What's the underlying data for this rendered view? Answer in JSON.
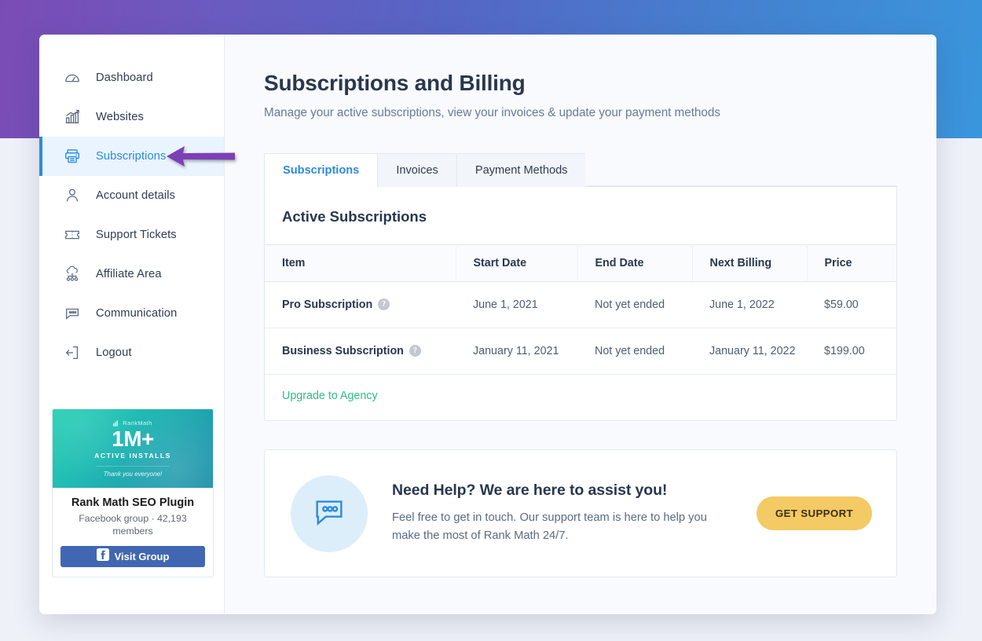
{
  "theme": {
    "gradient_start": "#7b4bb5",
    "gradient_end": "#3a96dc",
    "accent_blue": "#2b8ae0",
    "accent_green": "#2dbd84",
    "accent_yellow": "#f3ca63",
    "facebook_blue": "#4267b2",
    "page_bg": "#eef1f8"
  },
  "sidebar": {
    "items": [
      {
        "label": "Dashboard",
        "icon": "gauge-icon",
        "active": false
      },
      {
        "label": "Websites",
        "icon": "bar-chart-icon",
        "active": false
      },
      {
        "label": "Subscriptions",
        "icon": "invoice-printer-icon",
        "active": true
      },
      {
        "label": "Account details",
        "icon": "user-icon",
        "active": false
      },
      {
        "label": "Support Tickets",
        "icon": "ticket-icon",
        "active": false
      },
      {
        "label": "Affiliate Area",
        "icon": "affiliate-network-icon",
        "active": false
      },
      {
        "label": "Communication",
        "icon": "speech-bubble-icon",
        "active": false
      },
      {
        "label": "Logout",
        "icon": "logout-icon",
        "active": false
      }
    ],
    "promo": {
      "banner_logo": "RankMath",
      "banner_headline": "1M+",
      "banner_subhead": "ACTIVE INSTALLS",
      "banner_thanks": "Thank you everyone!",
      "title": "Rank Math SEO Plugin",
      "meta": "Facebook group · 42,193 members",
      "button_label": "Visit Group"
    }
  },
  "main": {
    "title": "Subscriptions and Billing",
    "subtitle": "Manage your active subscriptions, view your invoices & update your payment methods",
    "tabs": [
      {
        "label": "Subscriptions",
        "active": true
      },
      {
        "label": "Invoices",
        "active": false
      },
      {
        "label": "Payment Methods",
        "active": false
      }
    ],
    "panel": {
      "heading": "Active Subscriptions",
      "columns": [
        "Item",
        "Start Date",
        "End Date",
        "Next Billing",
        "Price"
      ],
      "rows": [
        {
          "item": "Pro Subscription",
          "help": "?",
          "start_date": "June 1, 2021",
          "end_date": "Not yet ended",
          "next_billing": "June 1, 2022",
          "price": "$59.00"
        },
        {
          "item": "Business Subscription",
          "help": "?",
          "start_date": "January 11, 2021",
          "end_date": "Not yet ended",
          "next_billing": "January 11, 2022",
          "price": "$199.00"
        }
      ],
      "upgrade_link": "Upgrade to Agency"
    },
    "support": {
      "title": "Need Help? We are here to assist you!",
      "description": "Feel free to get in touch. Our support team is here to help you make the most of Rank Math 24/7.",
      "button_label": "GET SUPPORT"
    }
  }
}
